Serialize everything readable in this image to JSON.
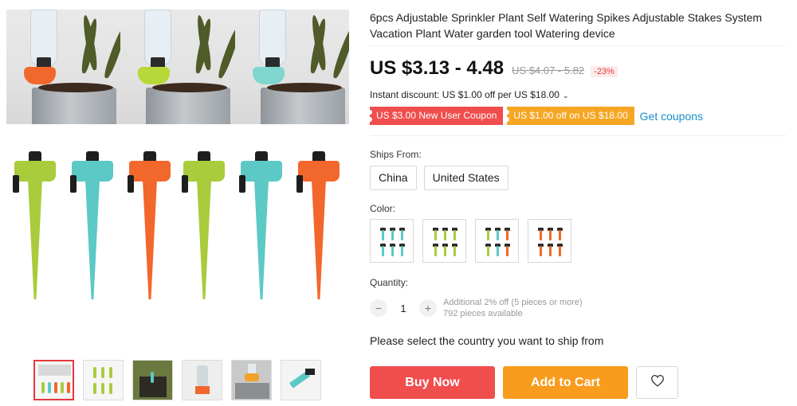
{
  "product": {
    "title": "6pcs Adjustable Sprinkler Plant Self Watering Spikes Adjustable Stakes System Vacation Plant Water garden tool Watering device"
  },
  "pricing": {
    "price": "US $3.13 - 4.48",
    "old_price": "US $4.07 - 5.82",
    "discount_badge": "-23%",
    "instant_discount": "Instant discount: US $1.00 off per US $18.00",
    "instant_discount_chevron": "⌄"
  },
  "coupons": {
    "items": [
      "US $3.00 New User Coupon",
      "US $1.00 off on US $18.00"
    ],
    "get_coupons_label": "Get coupons"
  },
  "ships_from": {
    "label": "Ships From:",
    "options": [
      "China",
      "United States"
    ]
  },
  "color": {
    "label": "Color:",
    "swatches": [
      "blue",
      "green",
      "mixed",
      "orange"
    ]
  },
  "quantity": {
    "label": "Quantity:",
    "minus": "−",
    "value": "1",
    "plus": "+",
    "note": "Additional 2% off (5 pieces or more)",
    "available": "792 pieces available"
  },
  "ship_note": "Please select the country you want to ship from",
  "actions": {
    "buy_now": "Buy Now",
    "add_to_cart": "Add to Cart",
    "wishlist_icon": "heart-icon"
  },
  "colors": {
    "green": "#a8cc3c",
    "blue": "#5cc9c6",
    "orange": "#f2672b",
    "coupon_red": "#f04d4d",
    "coupon_orange": "#f5a623",
    "link": "#1a8dc8"
  }
}
